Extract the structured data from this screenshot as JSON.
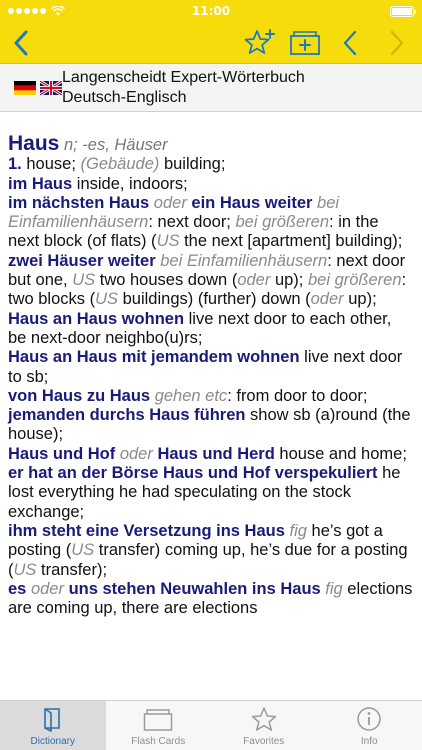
{
  "status_bar": {
    "carrier_signal": "•••••",
    "time": "11:00"
  },
  "toolbar": {
    "icons": [
      "chevron-left",
      "star-plus",
      "add-to-flashcards",
      "chevron-left",
      "chevron-right"
    ],
    "accent_color": "#1a7ac0",
    "background_color": "#f7dc0c"
  },
  "dictionary": {
    "flags": [
      "german-flag",
      "uk-flag"
    ],
    "title_line1": "Langenscheidt Expert-Wörterbuch",
    "title_line2": "Deutsch-Englisch"
  },
  "entry": {
    "headword": "Haus",
    "grammar": "n; -es, Häuser",
    "sense_number": "1.",
    "sense_1": {
      "a": "house; ",
      "b": "(Gebäude)",
      "c": " building;"
    },
    "phrase_1": {
      "a": "im Haus",
      "b": " inside, indoors;"
    },
    "phrase_2": {
      "a": "im nächsten Haus",
      "b": " oder ",
      "c": "ein Haus weiter",
      "d": " bei Einfamilienhäusern",
      "e": ": next door; ",
      "f": "bei größeren",
      "g": ": in the next block (of flats) (",
      "h": "US",
      "i": " the next [apartment] building);"
    },
    "phrase_3": {
      "a": "zwei Häuser weiter",
      "b": " bei Einfamilienhäusern",
      "c": ": next door but one, ",
      "d": "US",
      "e": " two houses down (",
      "f": "oder",
      "g": " up); ",
      "h": "bei größeren",
      "i": ": two blocks (",
      "j": "US",
      "k": " buildings) (further) down (",
      "l": "oder",
      "m": " up);"
    },
    "phrase_4": {
      "a": "Haus an Haus wohnen",
      "b": " live next door to each other, be next-door neighbo(u)rs;"
    },
    "phrase_5": {
      "a": "Haus an Haus mit jemandem wohnen",
      "b": " live next door to sb;"
    },
    "phrase_6": {
      "a": "von Haus zu Haus",
      "b": " gehen etc",
      "c": ": from door to door;"
    },
    "phrase_7": {
      "a": "jemanden durchs Haus führen",
      "b": " show sb (a)round (the house);"
    },
    "phrase_8": {
      "a": "Haus und Hof",
      "b": " oder ",
      "c": "Haus und Herd",
      "d": " house and home;"
    },
    "phrase_9": {
      "a": "er hat an der Börse Haus und Hof verspekuliert",
      "b": " he lost everything he had speculating on the stock exchange;"
    },
    "phrase_10": {
      "a": "ihm steht eine Versetzung ins Haus",
      "b": " fig",
      "c": " he’s got a posting (",
      "d": "US",
      "e": " transfer) coming up, he’s due for a posting (",
      "f": "US",
      "g": " transfer);"
    },
    "phrase_11": {
      "a": "es",
      "b": " oder ",
      "c": "uns stehen Neuwahlen ins Haus",
      "d": " fig",
      "e": " elections are coming up, there are elections"
    }
  },
  "tab_bar": {
    "tabs": [
      {
        "label": "Dictionary",
        "icon": "book-icon",
        "active": true
      },
      {
        "label": "Flash Cards",
        "icon": "cards-icon",
        "active": false
      },
      {
        "label": "Favorites",
        "icon": "star-icon",
        "active": false
      },
      {
        "label": "Info",
        "icon": "info-icon",
        "active": false
      }
    ]
  }
}
